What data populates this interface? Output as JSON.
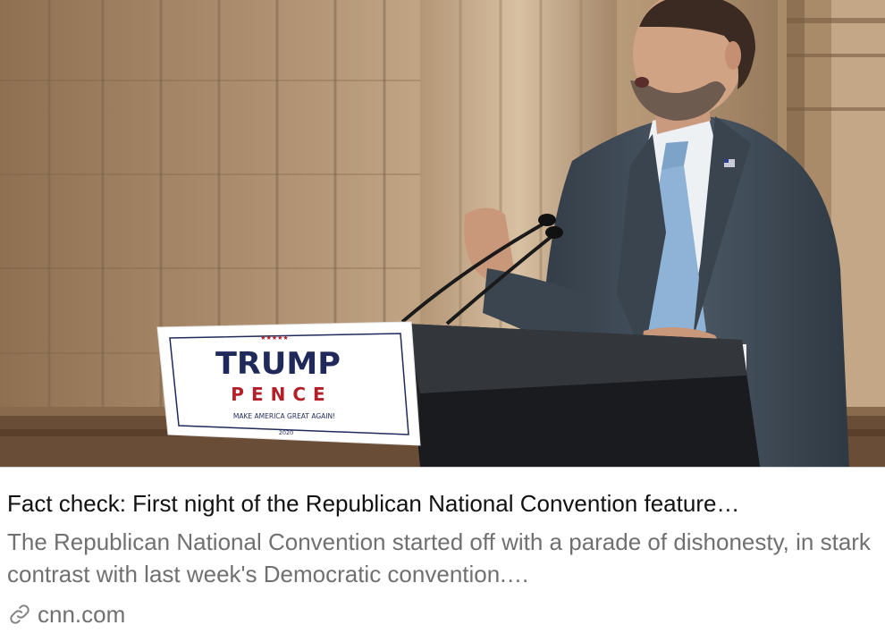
{
  "preview": {
    "title": "Fact check: First night of the Republican National Convention feature…",
    "description": "The Republican National Convention started off with a parade of dishonesty, in stark contrast with last week's Democratic convention.…",
    "domain": "cnn.com",
    "link_icon": "link-icon"
  },
  "image": {
    "sign": {
      "line1": "TRUMP",
      "line2": "PENCE",
      "slogan": "MAKE AMERICA GREAT AGAIN!",
      "year": "2020",
      "stars": "★★★★★"
    },
    "colors": {
      "navy": "#1f2a5a",
      "red": "#b3202a",
      "wall": "#a98a68",
      "suit": "#3f4b57",
      "tie": "#8fb3d6"
    }
  }
}
